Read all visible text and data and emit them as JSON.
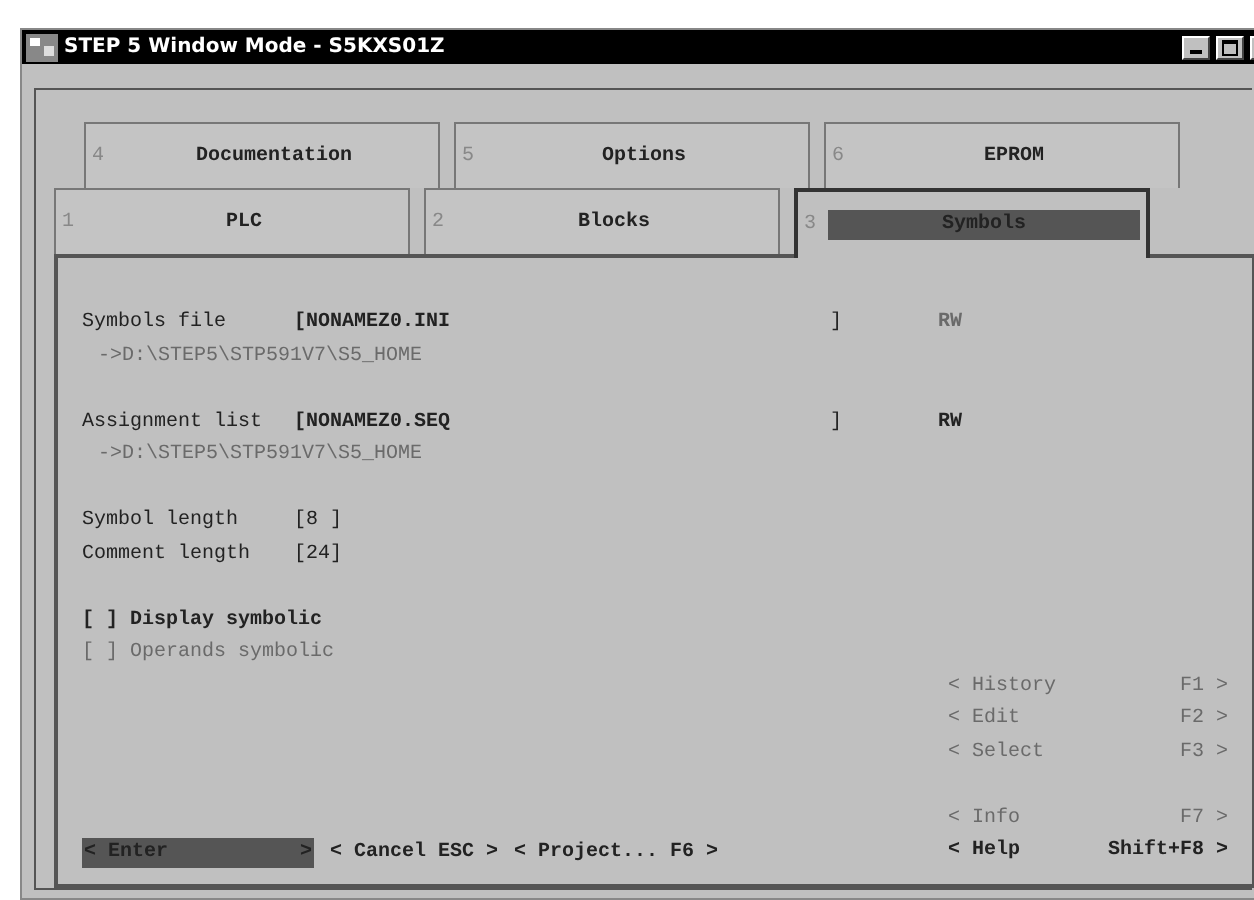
{
  "window": {
    "title": "STEP 5 Window Mode - S5KXS01Z"
  },
  "tabs_back": [
    {
      "number": "4",
      "label": "Documentation",
      "selected": false
    },
    {
      "number": "5",
      "label": "Options",
      "selected": false
    },
    {
      "number": "6",
      "label": "EPROM",
      "selected": false
    }
  ],
  "tabs_front": [
    {
      "number": "1",
      "label": "PLC",
      "selected": false
    },
    {
      "number": "2",
      "label": "Blocks",
      "selected": false
    },
    {
      "number": "3",
      "label": "Symbols",
      "selected": true
    }
  ],
  "files": [
    {
      "label": "Symbols file",
      "value": "[NONAMEZ0.INI",
      "close": "]",
      "access": "RW",
      "access_enabled": false,
      "path": "->D:\\STEP5\\STP591V7\\S5_HOME"
    },
    {
      "label": "Assignment list",
      "value": "[NONAMEZ0.SEQ",
      "close": "]",
      "access": "RW",
      "access_enabled": true,
      "path": "->D:\\STEP5\\STP591V7\\S5_HOME"
    }
  ],
  "lengths": [
    {
      "label": "Symbol length",
      "value": "[8 ]"
    },
    {
      "label": "Comment length",
      "value": "[24]"
    }
  ],
  "options": [
    {
      "box": "[ ]",
      "label": "Display symbolic",
      "checked": false,
      "disabled": false
    },
    {
      "box": "[ ]",
      "label": "Operands symbolic",
      "checked": false,
      "disabled": true
    }
  ],
  "function_keys": [
    {
      "label": "< History",
      "key": "F1 >",
      "disabled": true
    },
    {
      "label": "< Edit",
      "key": "F2 >",
      "disabled": true
    },
    {
      "label": "< Select",
      "key": "F3 >",
      "disabled": true
    },
    {
      "label": "< Info",
      "key": "F7 >",
      "disabled": true,
      "gap": true
    },
    {
      "label": "< Help",
      "key": "Shift+F8 >",
      "disabled": false
    }
  ],
  "buttons": [
    {
      "label": "< Enter",
      "end": ">",
      "selected": true
    },
    {
      "label": "< Cancel  ESC >",
      "selected": false
    },
    {
      "label": "< Project... F6 >",
      "selected": false
    }
  ]
}
